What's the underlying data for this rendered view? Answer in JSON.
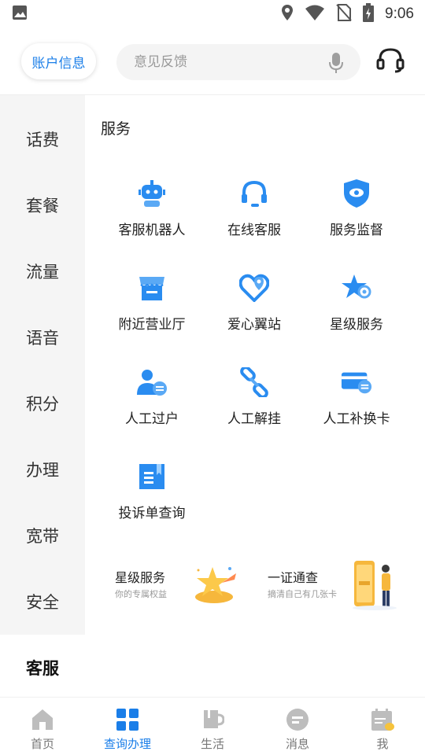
{
  "status_bar": {
    "time": "9:06"
  },
  "header": {
    "account_label": "账户信息",
    "search_placeholder": "意见反馈"
  },
  "sidebar": {
    "items": [
      {
        "label": "话费",
        "active": false
      },
      {
        "label": "套餐",
        "active": false
      },
      {
        "label": "流量",
        "active": false
      },
      {
        "label": "语音",
        "active": false
      },
      {
        "label": "积分",
        "active": false
      },
      {
        "label": "办理",
        "active": false
      },
      {
        "label": "宽带",
        "active": false
      },
      {
        "label": "安全",
        "active": false
      },
      {
        "label": "客服",
        "active": true
      }
    ]
  },
  "main": {
    "section_title": "服务",
    "services": [
      {
        "label": "客服机器人",
        "icon": "robot-icon"
      },
      {
        "label": "在线客服",
        "icon": "headset-icon"
      },
      {
        "label": "服务监督",
        "icon": "shield-eye-icon"
      },
      {
        "label": "附近营业厅",
        "icon": "store-icon"
      },
      {
        "label": "爱心翼站",
        "icon": "heart-pin-icon"
      },
      {
        "label": "星级服务",
        "icon": "star-icon"
      },
      {
        "label": "人工过户",
        "icon": "user-transfer-icon"
      },
      {
        "label": "人工解挂",
        "icon": "unlink-icon"
      },
      {
        "label": "人工补换卡",
        "icon": "card-swap-icon"
      },
      {
        "label": "投诉单查询",
        "icon": "document-icon"
      }
    ],
    "promos": [
      {
        "title": "星级服务",
        "subtitle": "你的专属权益"
      },
      {
        "title": "一证通查",
        "subtitle": "摘清自己有几张卡"
      }
    ]
  },
  "bottom_nav": {
    "items": [
      {
        "label": "首页",
        "active": false
      },
      {
        "label": "查询办理",
        "active": true
      },
      {
        "label": "生活",
        "active": false
      },
      {
        "label": "消息",
        "active": false
      },
      {
        "label": "我",
        "active": false
      }
    ]
  },
  "colors": {
    "accent": "#1a7ee8",
    "icon_blue": "#2a8cf0",
    "sidebar_bg": "#f5f5f5",
    "inactive_icon": "#bdbdbd"
  }
}
